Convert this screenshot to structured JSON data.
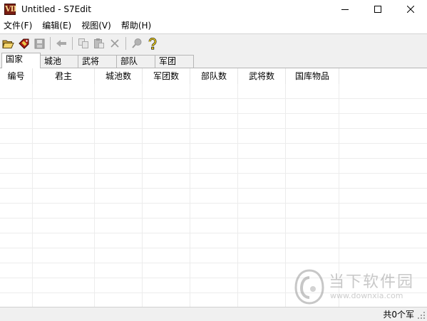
{
  "window": {
    "title": "Untitled - S7Edit",
    "icon_text": "VII",
    "controls": [
      "minimize",
      "maximize",
      "close"
    ]
  },
  "menu": {
    "items": [
      "文件(F)",
      "编辑(E)",
      "视图(V)",
      "帮助(H)"
    ]
  },
  "toolbar": {
    "buttons": [
      "open-folder-icon",
      "tag-icon",
      "save-icon",
      "back-arrow-icon",
      "copy-icon",
      "paste-icon",
      "delete-icon",
      "find-icon",
      "help-icon"
    ]
  },
  "tabs": {
    "items": [
      "国家",
      "城池",
      "武将",
      "部队",
      "军团"
    ],
    "active": "国家"
  },
  "grid": {
    "columns": [
      "编号",
      "君主",
      "城池数",
      "军团数",
      "部队数",
      "武将数",
      "国库物品"
    ],
    "rows": []
  },
  "watermark": {
    "brand": "当下软件园",
    "url": "www.downxia.com"
  },
  "statusbar": {
    "text": "共0个军"
  },
  "colors": {
    "chrome": "#f0f0f0",
    "grid_line": "#ececec",
    "icon_red": "#7a1e12"
  }
}
